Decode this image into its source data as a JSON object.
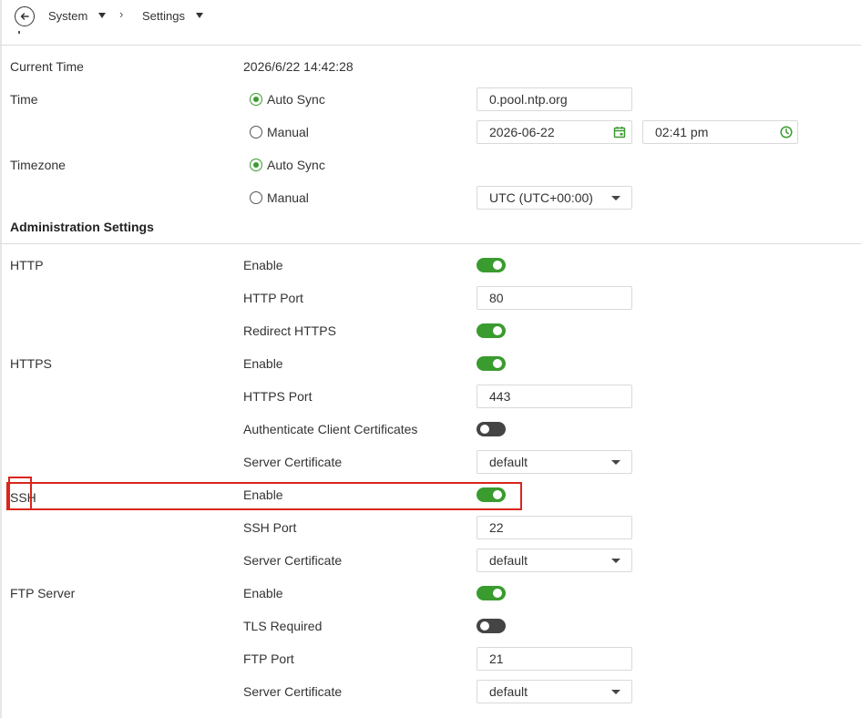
{
  "breadcrumb": {
    "items": [
      {
        "label": "System"
      },
      {
        "label": "Settings"
      }
    ]
  },
  "time_settings": {
    "current_time_label": "Current Time",
    "current_time_value": "2026/6/22 14:42:28",
    "time_label": "Time",
    "time_auto_sync_label": "Auto Sync",
    "time_manual_label": "Manual",
    "ntp_server_value": "0.pool.ntp.org",
    "date_value": "2026-06-22",
    "time_value": "02:41 pm",
    "timezone_label": "Timezone",
    "timezone_auto_sync_label": "Auto Sync",
    "timezone_manual_label": "Manual",
    "timezone_value": "UTC (UTC+00:00)",
    "time_mode": "Auto Sync",
    "timezone_mode": "Auto Sync"
  },
  "admin": {
    "title": "Administration Settings",
    "http": {
      "label": "HTTP",
      "enable_label": "Enable",
      "enabled": true,
      "port_label": "HTTP Port",
      "port_value": "80",
      "redirect_label": "Redirect HTTPS",
      "redirect_enabled": true
    },
    "https": {
      "label": "HTTPS",
      "enable_label": "Enable",
      "enabled": true,
      "port_label": "HTTPS Port",
      "port_value": "443",
      "client_cert_label": "Authenticate Client Certificates",
      "client_cert_enabled": false,
      "server_cert_label": "Server Certificate",
      "server_cert_value": "default"
    },
    "ssh": {
      "label": "SSH",
      "enable_label": "Enable",
      "enabled": true,
      "port_label": "SSH Port",
      "port_value": "22",
      "server_cert_label": "Server Certificate",
      "server_cert_value": "default"
    },
    "ftp": {
      "label": "FTP Server",
      "enable_label": "Enable",
      "enabled": true,
      "tls_label": "TLS Required",
      "tls_enabled": false,
      "port_label": "FTP Port",
      "port_value": "21",
      "server_cert_label": "Server Certificate",
      "server_cert_value": "default"
    }
  },
  "colors": {
    "accent_green": "#3a9b2f",
    "toggle_off": "#444444",
    "highlight_red": "#d9261c"
  }
}
